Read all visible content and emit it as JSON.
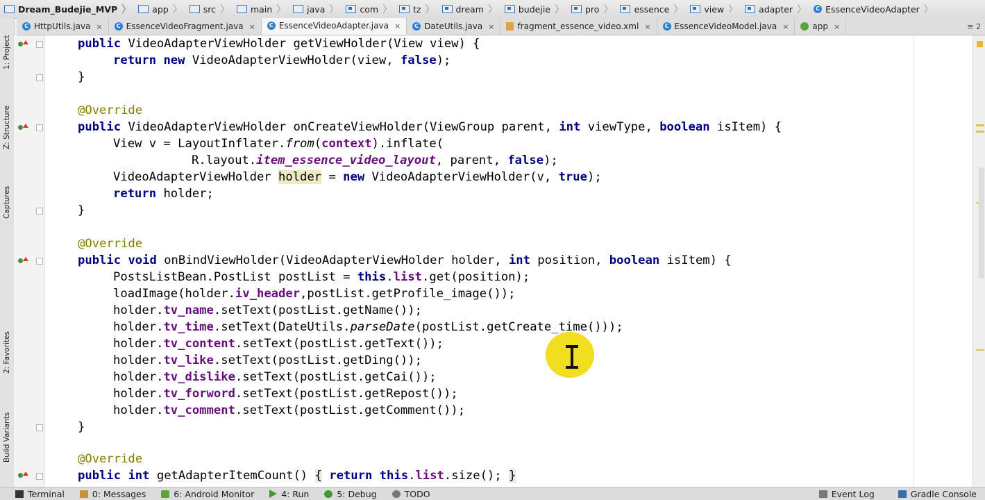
{
  "breadcrumbs": [
    "Dream_Budejie_MVP",
    "app",
    "src",
    "main",
    "java",
    "com",
    "tz",
    "dream",
    "budejie",
    "pro",
    "essence",
    "view",
    "adapter",
    "EssenceVideoAdapter"
  ],
  "tabs": [
    {
      "label": "HttpUtils.java",
      "icon": "class-icon",
      "active": false
    },
    {
      "label": "EssenceVideoFragment.java",
      "icon": "class-icon",
      "active": false
    },
    {
      "label": "EssenceVideoAdapter.java",
      "icon": "class-icon",
      "active": true
    },
    {
      "label": "DateUtils.java",
      "icon": "class-icon",
      "active": false
    },
    {
      "label": "fragment_essence_video.xml",
      "icon": "xml-icon",
      "active": false
    },
    {
      "label": "EssenceVideoModel.java",
      "icon": "class-icon",
      "active": false
    },
    {
      "label": "app",
      "icon": "android-icon",
      "active": false
    }
  ],
  "tab_overflow": "≡ 2",
  "tab_close_glyph": "×",
  "left_tools": [
    "1: Project",
    "Z: Structure",
    "Captures",
    "2: Favorites",
    "Build Variants"
  ],
  "bottom_tools": {
    "left": [
      {
        "label": "Terminal",
        "icon": "terminal-icon"
      },
      {
        "label": "0: Messages",
        "icon": "messages-icon"
      },
      {
        "label": "6: Android Monitor",
        "icon": "android-monitor-icon"
      },
      {
        "label": "4: Run",
        "icon": "run-icon"
      },
      {
        "label": "5: Debug",
        "icon": "debug-icon"
      },
      {
        "label": "TODO",
        "icon": "todo-icon"
      }
    ],
    "right": [
      {
        "label": "Event Log",
        "icon": "event-log-icon"
      },
      {
        "label": "Gradle Console",
        "icon": "gradle-console-icon"
      }
    ]
  },
  "code": {
    "l1": {
      "kw1": "public",
      "t1": " VideoAdapterViewHolder getViewHolder(View view) {"
    },
    "l2": {
      "kw1": "return",
      "kw2": "new",
      "t1": " VideoAdapterViewHolder(view, ",
      "kw3": "false",
      "t2": ");"
    },
    "l3": "}",
    "l5": "@Override",
    "l6": {
      "kw1": "public",
      "t1": " VideoAdapterViewHolder onCreateViewHolder(ViewGroup parent, ",
      "kw2": "int",
      "t2": " viewType, ",
      "kw3": "boolean",
      "t3": " isItem) {"
    },
    "l7": {
      "t1": "View v = LayoutInflater.",
      "it": "from",
      "t2": "(",
      "kw1": "context",
      "t3": ").inflate("
    },
    "l8": {
      "t1": "R.layout.",
      "fld": "item_essence_video_layout",
      "t2": ", parent, ",
      "kw1": "false",
      "t3": ");"
    },
    "l9": {
      "t1": "VideoAdapterViewHolder ",
      "hl": "holder",
      "t2": " = ",
      "kw1": "new",
      "t3": " VideoAdapterViewHolder(v, ",
      "kw2": "true",
      "t4": ");"
    },
    "l10": {
      "kw1": "return",
      "t1": " holder;"
    },
    "l11": "}",
    "l13": "@Override",
    "l14": {
      "kw1": "public",
      "kw2": "void",
      "t1": " onBindViewHolder(VideoAdapterViewHolder holder, ",
      "kw3": "int",
      "t2": " position, ",
      "kw4": "boolean",
      "t3": " isItem) {"
    },
    "l15": {
      "t1": "PostsListBean.PostList postList = ",
      "kw1": "this",
      "t2": ".",
      "fld": "list",
      "t3": ".get(position);"
    },
    "l16": {
      "t1": "loadImage(holder.",
      "fld": "iv_header",
      "t2": ",postList.getProfile_image());"
    },
    "l17": {
      "t1": "holder.",
      "fld": "tv_name",
      "t2": ".setText(postList.getName());"
    },
    "l18": {
      "t1": "holder.",
      "fld": "tv_time",
      "t2": ".setText(DateUtils.",
      "it": "parseDate",
      "t3": "(postList.getCreate_time()));"
    },
    "l19": {
      "t1": "holder.",
      "fld": "tv_content",
      "t2": ".setText(postList.getText());"
    },
    "l20": {
      "t1": "holder.",
      "fld": "tv_like",
      "t2": ".setText(postList.getDing());"
    },
    "l21": {
      "t1": "holder.",
      "fld": "tv_dislike",
      "t2": ".setText(postList.getCai());"
    },
    "l22": {
      "t1": "holder.",
      "fld": "tv_forword",
      "t2": ".setText(postList.getRepost());"
    },
    "l23": {
      "t1": "holder.",
      "fld": "tv_comment",
      "t2": ".setText(postList.getComment());"
    },
    "l24": "}",
    "l26": "@Override",
    "l27": {
      "kw1": "public",
      "kw2": "int",
      "t1": " getAdapterItemCount() ",
      "b1": "{",
      "kw3": "return",
      "kw4": "this",
      "t2": ".",
      "fld": "list",
      "t3": ".size(); ",
      "b2": "}"
    }
  },
  "colors": {
    "keyword": "#000080",
    "field": "#660e7a",
    "annotation": "#808000",
    "cursor_highlight": "#f0dc14"
  }
}
